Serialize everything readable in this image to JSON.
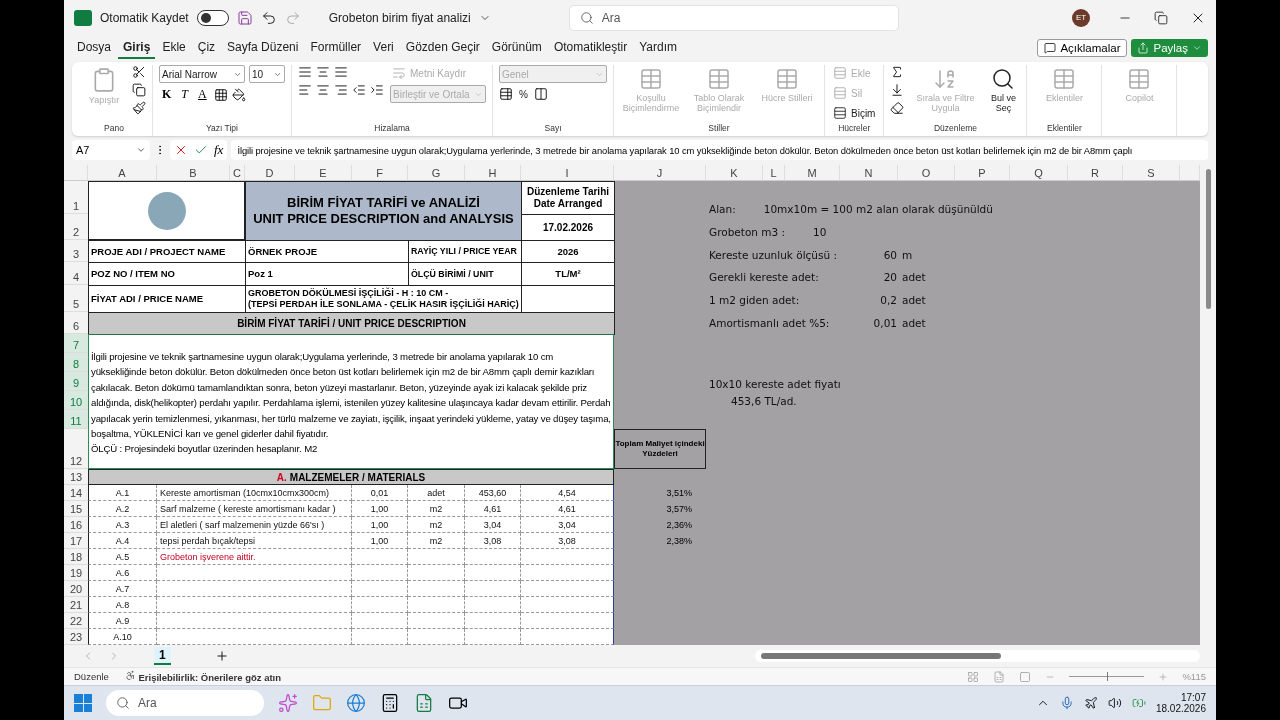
{
  "title_bar": {
    "autosave_label": "Otomatik Kaydet",
    "autosave_on": false,
    "document_title": "Grobeton birim fiyat analizi",
    "search_placeholder": "Ara",
    "user_initials": "ET"
  },
  "menu_tabs": [
    {
      "label": "Dosya",
      "selected": false
    },
    {
      "label": "Giriş",
      "selected": true
    },
    {
      "label": "Ekle",
      "selected": false
    },
    {
      "label": "Çiz",
      "selected": false
    },
    {
      "label": "Sayfa Düzeni",
      "selected": false
    },
    {
      "label": "Formüller",
      "selected": false
    },
    {
      "label": "Veri",
      "selected": false
    },
    {
      "label": "Gözden Geçir",
      "selected": false
    },
    {
      "label": "Görünüm",
      "selected": false
    },
    {
      "label": "Otomatikleştir",
      "selected": false
    },
    {
      "label": "Yardım",
      "selected": false
    }
  ],
  "comments_button": "Açıklamalar",
  "share_button": "Paylaş",
  "ribbon": [
    {
      "kind": "clipboard",
      "title": "Pano",
      "items": [
        {
          "label": "Yapıştır",
          "disabled": true
        }
      ]
    },
    {
      "kind": "font",
      "title": "Yazı Tipi",
      "font_name": "Arial Narrow",
      "font_size": "10",
      "bold": "K",
      "italic": "T",
      "underline": "A"
    },
    {
      "kind": "alignment",
      "title": "Hizalama",
      "items": [
        {
          "label": "Metni Kaydır",
          "disabled": true
        },
        {
          "label": "Birleştir ve Ortala",
          "disabled": true
        }
      ]
    },
    {
      "kind": "number",
      "title": "Sayı",
      "format": "Genel",
      "percent": "%"
    },
    {
      "kind": "large",
      "title": "Stiller",
      "items": [
        {
          "label": "Koşullu Biçimlendirme",
          "disabled": true
        },
        {
          "label": "Tablo Olarak Biçimlendir",
          "disabled": true
        },
        {
          "label": "Hücre Stilleri",
          "disabled": true
        }
      ]
    },
    {
      "kind": "small",
      "title": "Hücreler",
      "items": [
        {
          "label": "Ekle",
          "disabled": true
        },
        {
          "label": "Sil",
          "disabled": true
        },
        {
          "label": "Biçim",
          "disabled": false
        }
      ]
    },
    {
      "kind": "editing",
      "title": "Düzenleme",
      "items": [
        {
          "label": "Sırala ve Filtre Uygula",
          "disabled": true
        },
        {
          "label": "Bul ve Seç",
          "disabled": false
        }
      ]
    },
    {
      "kind": "large",
      "title": "Eklentiler",
      "items": [
        {
          "label": "Eklentiler",
          "disabled": true
        }
      ]
    },
    {
      "kind": "large",
      "items": [
        {
          "label": "Copilot",
          "disabled": true
        }
      ]
    }
  ],
  "formula_bar": {
    "cell_ref": "A7",
    "function_label": "fx",
    "content": "İlgili projesine ve teknik şartnamesine uygun olarak;Uygulama yerlerinde, 3 metrede bir anolama yapılarak 10 cm yüksekliğinde beton dökülür. Beton dökülmeden önce beton üst kotları belirlemek için m2 de bir  A8mm çaplı"
  },
  "columns": [
    "A",
    "B",
    "C",
    "D",
    "E",
    "F",
    "G",
    "H",
    "I",
    "J",
    "K",
    "L",
    "M",
    "N",
    "O",
    "P",
    "Q",
    "R",
    "S"
  ],
  "rows": [
    {
      "label": "1",
      "selected": false
    },
    {
      "label": "2",
      "selected": false
    },
    {
      "label": "3",
      "selected": false
    },
    {
      "label": "4",
      "selected": false
    },
    {
      "label": "5",
      "selected": false
    },
    {
      "label": "6",
      "selected": false
    },
    {
      "label": "7",
      "selected": true
    },
    {
      "label": "8",
      "selected": true
    },
    {
      "label": "9",
      "selected": true
    },
    {
      "label": "10",
      "selected": true
    },
    {
      "label": "11",
      "selected": true
    },
    {
      "label": "12",
      "selected": false
    },
    {
      "label": "13",
      "selected": false
    },
    {
      "label": "14",
      "selected": false
    },
    {
      "label": "15",
      "selected": false
    },
    {
      "label": "16",
      "selected": false
    },
    {
      "label": "17",
      "selected": false
    },
    {
      "label": "18",
      "selected": false
    },
    {
      "label": "19",
      "selected": false
    },
    {
      "label": "20",
      "selected": false
    },
    {
      "label": "21",
      "selected": false
    },
    {
      "label": "22",
      "selected": false
    },
    {
      "label": "23",
      "selected": false
    }
  ],
  "form": {
    "title_lines": [
      "BİRİM FİYAT TARİFİ ve ANALİZİ",
      "UNIT PRICE DESCRIPTION and ANALYSIS"
    ],
    "date_label_lines": [
      "Düzenleme Tarihi",
      "Date Arranged"
    ],
    "date": "17.02.2026",
    "info_rows": [
      {
        "label": "PROJE ADI / PROJECT NAME",
        "value": "ÖRNEK PROJE",
        "side_label": "RAYİÇ YILI / PRICE YEAR",
        "side_value": "2026"
      },
      {
        "label": "POZ NO / ITEM NO",
        "value": "Poz 1",
        "side_label": "ÖLÇÜ BİRİMİ / UNIT",
        "side_value": "TL/M²"
      }
    ],
    "name_label": "FİYAT ADI / PRICE NAME",
    "name_lines": [
      "GROBETON DÖKÜLMESİ İŞÇİLİĞİ  - H : 10 CM -",
      "(TEPSİ PERDAH İLE SONLAMA - ÇELİK HASIR İŞÇİLİĞİ HARİÇ)"
    ],
    "description_heading": "BİRİM FİYAT TARİFİ / UNIT PRICE DESCRIPTION",
    "description": "İlgili projesine ve teknik şartnamesine uygun olarak;Uygulama yerlerinde, 3 metrede bir anolama yapılarak 10 cm yüksekliğinde beton dökülür. Beton dökülmeden önce beton üst kotları belirlemek için m2 de bir  A8mm çaplı demir kazıkları çakılacak. Beton dökümü tamamlandıktan sonra, beton yüzeyi mastarlanır. Beton, yüzeyinde ayak izi kalacak şekilde priz aldığında, disk(helikopter) perdahı yapılır. Perdahlama işlemi, istenilen yüzey kalitesine ulaşıncaya kadar devam ettirilir. Perdah yapılacak yerin temizlenmesi, yıkanması, her türlü malzeme ve zayiatı, işçilik, inşaat yerindeki yükleme, yatay ve düşey taşıma, boşaltma, YÜKLENİCİ karı ve genel giderler dahil fiyatıdır.",
    "measure_note": "ÖLÇÜ : Projesindeki boyutlar üzerinden hesaplanır. M2",
    "share_heading": "Toplam Maliyet içindeki Yüzdeleri",
    "materials_letter": "A.",
    "materials_heading": "MALZEMELER / MATERIALS",
    "materials": [
      {
        "kind": "item",
        "code": "A.1",
        "description": "Kereste amortisman (10cmx10cmx300cm)",
        "quantity": "0,01",
        "unit": "adet",
        "unit_price": "453,60",
        "amount": "4,54",
        "share": "3,51%"
      },
      {
        "kind": "item",
        "code": "A.2",
        "description": "Sarf malzeme ( kereste amortismanı kadar )",
        "quantity": "1,00",
        "unit": "m2",
        "unit_price": "4,61",
        "amount": "4,61",
        "share": "3,57%"
      },
      {
        "kind": "item",
        "code": "A.3",
        "description": "El aletleri ( sarf malzemenin yüzde 66'sı )",
        "quantity": "1,00",
        "unit": "m2",
        "unit_price": "3,04",
        "amount": "3,04",
        "share": "2,36%"
      },
      {
        "kind": "item",
        "code": "A.4",
        "description": "tepsi perdah bıçak/tepsi",
        "quantity": "1,00",
        "unit": "m2",
        "unit_price": "3,08",
        "amount": "3,08",
        "share": "2,38%"
      },
      {
        "kind": "note",
        "code": "A.5",
        "description": "Grobeton işverene aittir."
      },
      {
        "kind": "empty",
        "code": "A.6"
      },
      {
        "kind": "empty",
        "code": "A.7"
      },
      {
        "kind": "empty",
        "code": "A.8"
      },
      {
        "kind": "empty",
        "code": "A.9"
      },
      {
        "kind": "empty",
        "code": "A.10"
      }
    ]
  },
  "notes": [
    {
      "kind": "inline",
      "label": "Alan:",
      "value": "10mx10m = 100 m2 alan olarak düşünüldü"
    },
    {
      "kind": "inline",
      "label": "Grobeton m3 :",
      "value": "10"
    },
    {
      "kind": "measure",
      "label": "Kereste uzunluk ölçüsü :",
      "value": "60",
      "unit": "m"
    },
    {
      "kind": "measure",
      "label": "Gerekli kereste adet:",
      "value": "20",
      "unit": "adet"
    },
    {
      "kind": "measure",
      "label": "1 m2 giden adet:",
      "value": "0,2",
      "unit": "adet"
    },
    {
      "kind": "measure",
      "label": "Amortismanlı adet %5:",
      "value": "0,01",
      "unit": "adet"
    }
  ],
  "price_note": {
    "label": "10x10 kereste adet fiyatı",
    "value": "453,6 TL/ad."
  },
  "sheet_tabs": [
    {
      "label": "1",
      "selected": true
    }
  ],
  "status_bar": {
    "mode": "Düzenle",
    "accessibility": "Erişilebilirlik: Önerilere göz atın",
    "zoom": "%115",
    "zoom_slider": {
      "level": 0.5
    }
  },
  "taskbar": {
    "search_placeholder": "Ara",
    "time": "17:07",
    "date": "18.02.2026"
  }
}
